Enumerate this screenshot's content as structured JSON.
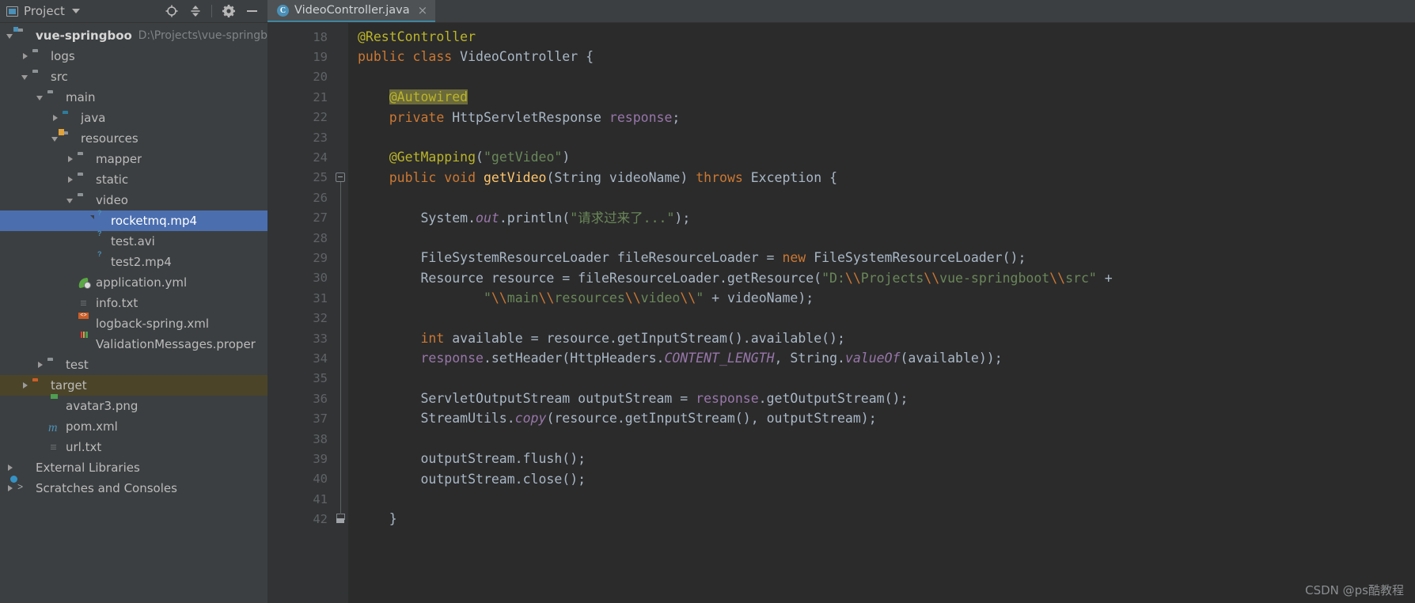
{
  "project_panel": {
    "title": "Project",
    "icons": [
      "project-window-icon",
      "chevron-down-icon",
      "locate-icon",
      "collapse-all-icon",
      "gear-icon",
      "minimize-icon"
    ],
    "tree": [
      {
        "label": "vue-springboot",
        "sub": "D:\\Projects\\vue-springb",
        "indent": 0,
        "arrow": "down",
        "icon": "folder-module",
        "bold": true,
        "state": "normal"
      },
      {
        "label": "logs",
        "sub": "",
        "indent": 1,
        "arrow": "right",
        "icon": "folder-gray",
        "bold": false,
        "state": "normal"
      },
      {
        "label": "src",
        "sub": "",
        "indent": 1,
        "arrow": "down",
        "icon": "folder-gray",
        "bold": false,
        "state": "normal"
      },
      {
        "label": "main",
        "sub": "",
        "indent": 2,
        "arrow": "down",
        "icon": "folder-gray",
        "bold": false,
        "state": "normal"
      },
      {
        "label": "java",
        "sub": "",
        "indent": 3,
        "arrow": "right",
        "icon": "folder-sources-blue",
        "bold": false,
        "state": "normal"
      },
      {
        "label": "resources",
        "sub": "",
        "indent": 3,
        "arrow": "down",
        "icon": "folder-resources",
        "bold": false,
        "state": "normal"
      },
      {
        "label": "mapper",
        "sub": "",
        "indent": 4,
        "arrow": "right",
        "icon": "folder-package",
        "bold": false,
        "state": "normal"
      },
      {
        "label": "static",
        "sub": "",
        "indent": 4,
        "arrow": "right",
        "icon": "folder-package",
        "bold": false,
        "state": "normal"
      },
      {
        "label": "video",
        "sub": "",
        "indent": 4,
        "arrow": "down",
        "icon": "folder-package",
        "bold": false,
        "state": "normal"
      },
      {
        "label": "rocketmq.mp4",
        "sub": "",
        "indent": 5,
        "arrow": "none",
        "icon": "file-unknown",
        "bold": false,
        "state": "selected"
      },
      {
        "label": "test.avi",
        "sub": "",
        "indent": 5,
        "arrow": "none",
        "icon": "file-unknown",
        "bold": false,
        "state": "normal"
      },
      {
        "label": "test2.mp4",
        "sub": "",
        "indent": 5,
        "arrow": "none",
        "icon": "file-unknown",
        "bold": false,
        "state": "normal"
      },
      {
        "label": "application.yml",
        "sub": "",
        "indent": 4,
        "arrow": "none",
        "icon": "spring-yml",
        "bold": false,
        "state": "normal"
      },
      {
        "label": "info.txt",
        "sub": "",
        "indent": 4,
        "arrow": "none",
        "icon": "file-text",
        "bold": false,
        "state": "normal"
      },
      {
        "label": "logback-spring.xml",
        "sub": "",
        "indent": 4,
        "arrow": "none",
        "icon": "file-xml",
        "bold": false,
        "state": "normal"
      },
      {
        "label": "ValidationMessages.proper",
        "sub": "",
        "indent": 4,
        "arrow": "none",
        "icon": "file-properties",
        "bold": false,
        "state": "normal"
      },
      {
        "label": "test",
        "sub": "",
        "indent": 2,
        "arrow": "right",
        "icon": "folder-gray",
        "bold": false,
        "state": "normal"
      },
      {
        "label": "target",
        "sub": "",
        "indent": 1,
        "arrow": "right",
        "icon": "folder-orange",
        "bold": false,
        "state": "highlight"
      },
      {
        "label": "avatar3.png",
        "sub": "",
        "indent": 2,
        "arrow": "none",
        "icon": "file-image",
        "bold": false,
        "state": "normal"
      },
      {
        "label": "pom.xml",
        "sub": "",
        "indent": 2,
        "arrow": "none",
        "icon": "maven-m",
        "bold": false,
        "state": "normal"
      },
      {
        "label": "url.txt",
        "sub": "",
        "indent": 2,
        "arrow": "none",
        "icon": "file-text",
        "bold": false,
        "state": "normal"
      },
      {
        "label": "External Libraries",
        "sub": "",
        "indent": 0,
        "arrow": "right",
        "icon": "libraries",
        "bold": false,
        "state": "normal"
      },
      {
        "label": "Scratches and Consoles",
        "sub": "",
        "indent": 0,
        "arrow": "right",
        "icon": "scratches",
        "bold": false,
        "state": "normal"
      }
    ]
  },
  "editor": {
    "tab": {
      "label": "VideoController.java",
      "icon": "java-class-icon",
      "close": "×",
      "badge": "C"
    },
    "first_line_number": 18,
    "lines": [
      {
        "n": 18,
        "mark": "spring-bean-icon",
        "fold": "none"
      },
      {
        "n": 19,
        "mark": "spring-class-icon",
        "fold": "none"
      },
      {
        "n": 20,
        "mark": "",
        "fold": "none"
      },
      {
        "n": 21,
        "mark": "",
        "fold": "none"
      },
      {
        "n": 22,
        "mark": "",
        "fold": "none"
      },
      {
        "n": 23,
        "mark": "",
        "fold": "none"
      },
      {
        "n": 24,
        "mark": "",
        "fold": "none"
      },
      {
        "n": 25,
        "mark": "",
        "fold": "collapse"
      },
      {
        "n": 26,
        "mark": "",
        "fold": "none"
      },
      {
        "n": 27,
        "mark": "",
        "fold": "none"
      },
      {
        "n": 28,
        "mark": "",
        "fold": "none"
      },
      {
        "n": 29,
        "mark": "",
        "fold": "none"
      },
      {
        "n": 30,
        "mark": "",
        "fold": "none"
      },
      {
        "n": 31,
        "mark": "intention-bulb-icon",
        "fold": "none"
      },
      {
        "n": 32,
        "mark": "",
        "fold": "none"
      },
      {
        "n": 33,
        "mark": "",
        "fold": "none"
      },
      {
        "n": 34,
        "mark": "",
        "fold": "none"
      },
      {
        "n": 35,
        "mark": "",
        "fold": "none"
      },
      {
        "n": 36,
        "mark": "",
        "fold": "none"
      },
      {
        "n": 37,
        "mark": "",
        "fold": "none"
      },
      {
        "n": 38,
        "mark": "",
        "fold": "none"
      },
      {
        "n": 39,
        "mark": "",
        "fold": "none"
      },
      {
        "n": 40,
        "mark": "",
        "fold": "none"
      },
      {
        "n": 41,
        "mark": "",
        "fold": "none"
      },
      {
        "n": 42,
        "mark": "",
        "fold": "end"
      }
    ],
    "code_lines": [
      [
        {
          "t": "@RestController",
          "c": "ann"
        }
      ],
      [
        {
          "t": "public class ",
          "c": "kw"
        },
        {
          "t": "VideoController ",
          "c": "plain"
        },
        {
          "t": "{",
          "c": "plain"
        }
      ],
      [],
      [
        {
          "t": "    ",
          "c": "plain"
        },
        {
          "t": "@Autowired",
          "c": "hl-ann"
        }
      ],
      [
        {
          "t": "    ",
          "c": "plain"
        },
        {
          "t": "private ",
          "c": "kw"
        },
        {
          "t": "HttpServletResponse ",
          "c": "plain"
        },
        {
          "t": "response",
          "c": "fld"
        },
        {
          "t": ";",
          "c": "plain"
        }
      ],
      [],
      [
        {
          "t": "    ",
          "c": "plain"
        },
        {
          "t": "@GetMapping",
          "c": "ann"
        },
        {
          "t": "(",
          "c": "plain"
        },
        {
          "t": "\"getVideo\"",
          "c": "str"
        },
        {
          "t": ")",
          "c": "plain"
        }
      ],
      [
        {
          "t": "    ",
          "c": "plain"
        },
        {
          "t": "public void ",
          "c": "kw"
        },
        {
          "t": "getVideo",
          "c": "mth"
        },
        {
          "t": "(String videoName) ",
          "c": "plain"
        },
        {
          "t": "throws ",
          "c": "kw"
        },
        {
          "t": "Exception {",
          "c": "plain"
        }
      ],
      [],
      [
        {
          "t": "        System.",
          "c": "plain"
        },
        {
          "t": "out",
          "c": "stat"
        },
        {
          "t": ".println(",
          "c": "plain"
        },
        {
          "t": "\"请求过来了...\"",
          "c": "str"
        },
        {
          "t": ");",
          "c": "plain"
        }
      ],
      [],
      [
        {
          "t": "        FileSystemResourceLoader fileResourceLoader = ",
          "c": "plain"
        },
        {
          "t": "new ",
          "c": "kw"
        },
        {
          "t": "FileSystemResourceLoader();",
          "c": "plain"
        }
      ],
      [
        {
          "t": "        Resource resource = fileResourceLoader.getResource(",
          "c": "plain"
        },
        {
          "t": "\"D:",
          "c": "str"
        },
        {
          "t": "\\\\",
          "c": "esc"
        },
        {
          "t": "Projects",
          "c": "str"
        },
        {
          "t": "\\\\",
          "c": "esc"
        },
        {
          "t": "vue-springboot",
          "c": "str"
        },
        {
          "t": "\\\\",
          "c": "esc"
        },
        {
          "t": "src\"",
          "c": "str"
        },
        {
          "t": " +",
          "c": "plain"
        }
      ],
      [
        {
          "t": "                ",
          "c": "plain"
        },
        {
          "t": "\"",
          "c": "str"
        },
        {
          "t": "\\\\",
          "c": "esc"
        },
        {
          "t": "main",
          "c": "str"
        },
        {
          "t": "\\\\",
          "c": "esc"
        },
        {
          "t": "resources",
          "c": "str"
        },
        {
          "t": "\\\\",
          "c": "esc"
        },
        {
          "t": "video",
          "c": "str"
        },
        {
          "t": "\\\\",
          "c": "esc"
        },
        {
          "t": "\"",
          "c": "str"
        },
        {
          "t": " + videoName);",
          "c": "plain"
        }
      ],
      [],
      [
        {
          "t": "        ",
          "c": "plain"
        },
        {
          "t": "int ",
          "c": "kw"
        },
        {
          "t": "available = resource.getInputStream().available();",
          "c": "plain"
        }
      ],
      [
        {
          "t": "        ",
          "c": "plain"
        },
        {
          "t": "response",
          "c": "fld"
        },
        {
          "t": ".setHeader(HttpHeaders.",
          "c": "plain"
        },
        {
          "t": "CONTENT_LENGTH",
          "c": "const"
        },
        {
          "t": ", String.",
          "c": "plain"
        },
        {
          "t": "valueOf",
          "c": "stat"
        },
        {
          "t": "(available));",
          "c": "plain"
        }
      ],
      [],
      [
        {
          "t": "        ServletOutputStream outputStream = ",
          "c": "plain"
        },
        {
          "t": "response",
          "c": "fld"
        },
        {
          "t": ".getOutputStream();",
          "c": "plain"
        }
      ],
      [
        {
          "t": "        StreamUtils.",
          "c": "plain"
        },
        {
          "t": "copy",
          "c": "stat"
        },
        {
          "t": "(resource.getInputStream(), outputStream);",
          "c": "plain"
        }
      ],
      [],
      [
        {
          "t": "        outputStream.flush();",
          "c": "plain"
        }
      ],
      [
        {
          "t": "        outputStream.close();",
          "c": "plain"
        }
      ],
      [],
      [
        {
          "t": "    }",
          "c": "plain"
        }
      ]
    ]
  },
  "watermark": "CSDN @ps酷教程",
  "colors": {
    "panel_bg": "#3c3f41",
    "editor_bg": "#2b2b2b",
    "gutter_bg": "#313335",
    "selection": "#4b6eaf",
    "highlight_row": "#4b4429",
    "tab_underline": "#3e86a0",
    "annotation": "#bbb529",
    "keyword": "#cc7832",
    "string": "#6a8759",
    "field": "#9876aa",
    "method": "#ffc66d",
    "default_text": "#a9b7c6"
  }
}
